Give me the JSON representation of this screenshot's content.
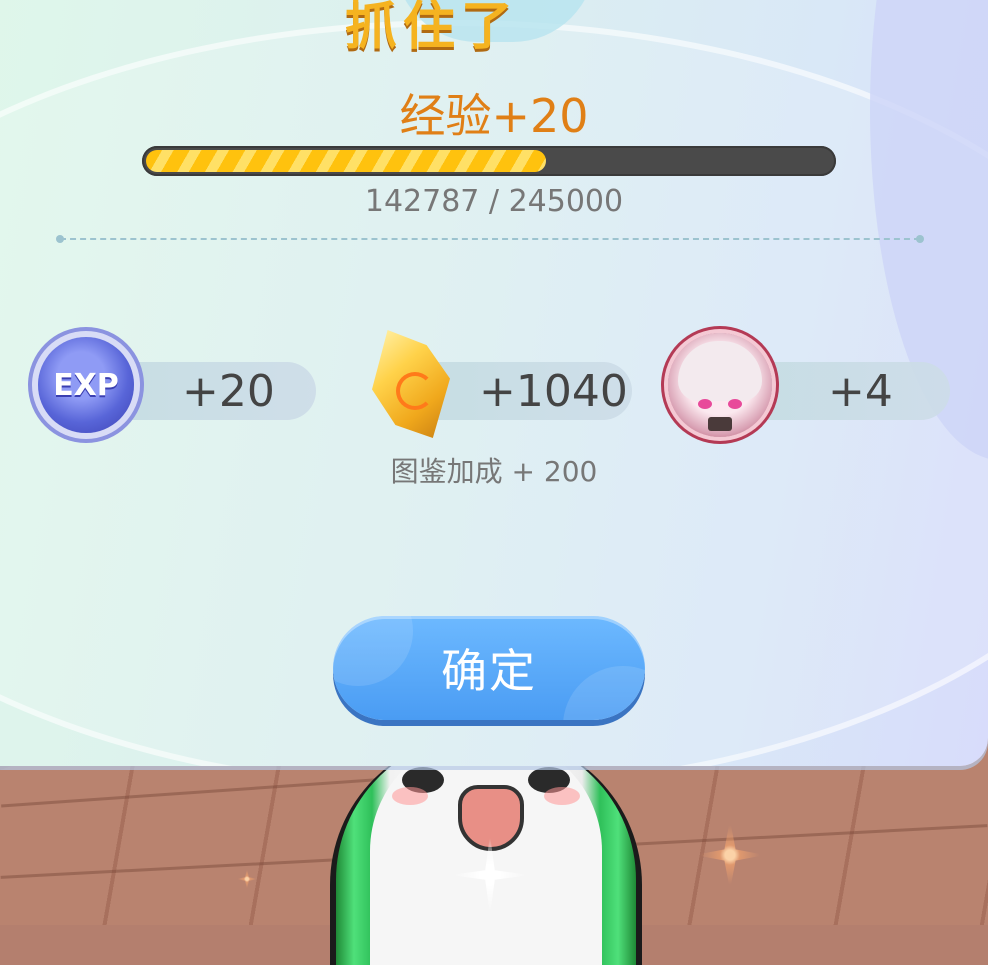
{
  "dialog": {
    "title": "抓住了",
    "exp_gain_label": "经验+20",
    "progress": {
      "current": 142787,
      "max": 245000,
      "text": "142787 / 245000",
      "fraction": 0.583
    },
    "rewards": [
      {
        "icon": "exp-icon",
        "amount": "+20"
      },
      {
        "icon": "gold-crystal-icon",
        "amount": "+1040"
      },
      {
        "icon": "character-portrait-icon",
        "amount": "+4"
      }
    ],
    "bonus_text": "图鉴加成 + 200",
    "confirm_label": "确定"
  },
  "colors": {
    "exp_title": "#e07f16",
    "progress_fill": "#ffc20e",
    "button": "#4a9cf3"
  }
}
